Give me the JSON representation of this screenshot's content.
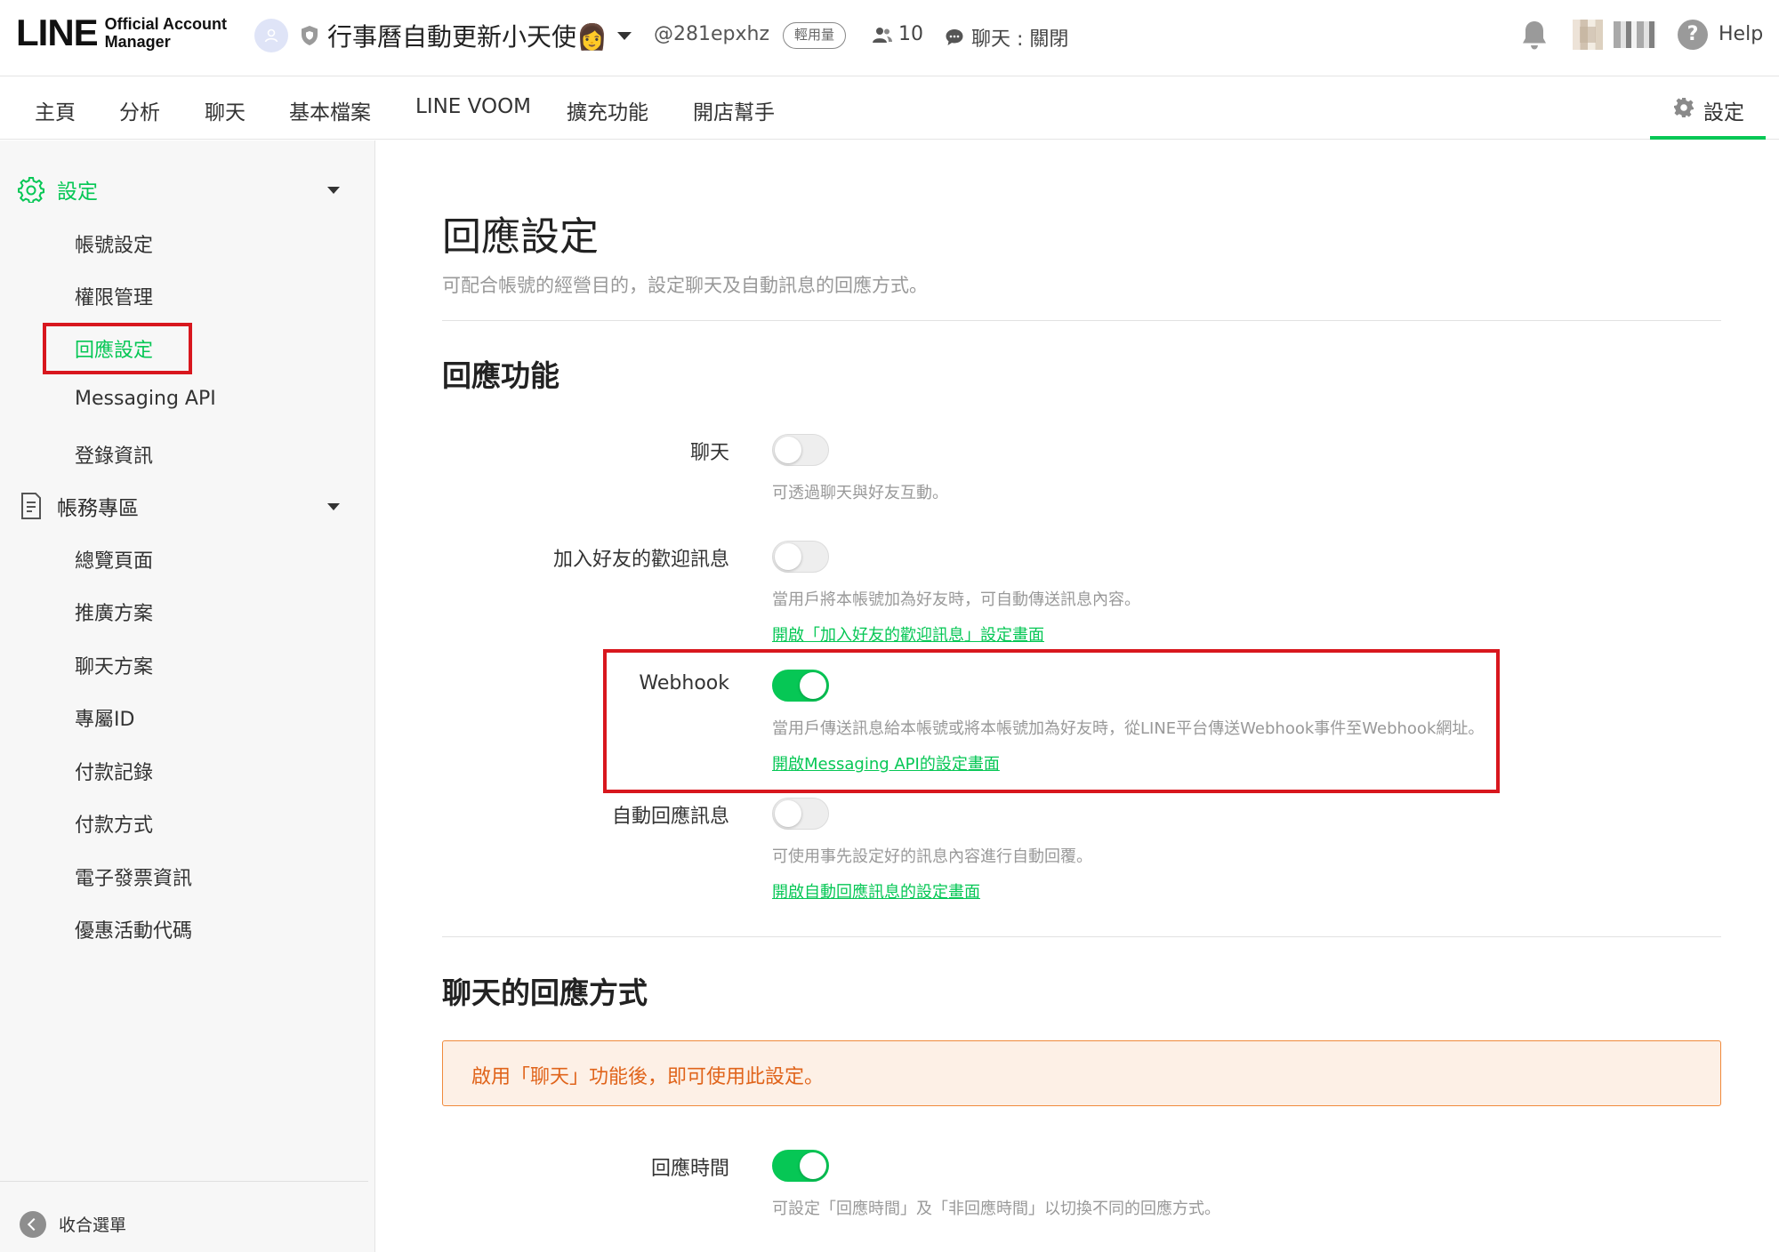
{
  "header": {
    "logo_main": "LINE",
    "logo_sub_1": "Official Account",
    "logo_sub_2": "Manager",
    "account_name": "行事曆自動更新小天使👩",
    "account_id": "@281epxhz",
    "plan_badge": "輕用量",
    "friends_count": "10",
    "chat_status": "聊天 : 關閉",
    "help_label": "Help"
  },
  "nav": {
    "tabs": [
      "主頁",
      "分析",
      "聊天",
      "基本檔案",
      "LINE VOOM",
      "擴充功能",
      "開店幫手"
    ],
    "settings_label": "設定"
  },
  "sidebar": {
    "section_settings": "設定",
    "settings_items": [
      "帳號設定",
      "權限管理",
      "回應設定",
      "Messaging API",
      "登錄資訊"
    ],
    "section_billing": "帳務專區",
    "billing_items": [
      "總覽頁面",
      "推廣方案",
      "聊天方案",
      "專屬ID",
      "付款記錄",
      "付款方式",
      "電子發票資訊",
      "優惠活動代碼"
    ],
    "collapse_label": "收合選單"
  },
  "main": {
    "title": "回應設定",
    "description": "可配合帳號的經營目的，設定聊天及自動訊息的回應方式。",
    "section_response": "回應功能",
    "rows": [
      {
        "label": "聊天",
        "enabled": false,
        "desc": "可透過聊天與好友互動。",
        "link": ""
      },
      {
        "label": "加入好友的歡迎訊息",
        "enabled": false,
        "desc": "當用戶將本帳號加為好友時，可自動傳送訊息內容。",
        "link": "開啟「加入好友的歡迎訊息」設定畫面"
      },
      {
        "label": "Webhook",
        "enabled": true,
        "desc": "當用戶傳送訊息給本帳號或將本帳號加為好友時，從LINE平台傳送Webhook事件至Webhook網址。",
        "link": "開啟Messaging API的設定畫面"
      },
      {
        "label": "自動回應訊息",
        "enabled": false,
        "desc": "可使用事先設定好的訊息內容進行自動回覆。",
        "link": "開啟自動回應訊息的設定畫面"
      }
    ],
    "section_chat_mode": "聊天的回應方式",
    "notice": "啟用「聊天」功能後，即可使用此設定。",
    "response_time": {
      "label": "回應時間",
      "enabled": true,
      "desc": "可設定「回應時間」及「非回應時間」以切換不同的回應方式。"
    }
  },
  "colors": {
    "brand_green": "#06c755",
    "highlight_red": "#d8171e",
    "notice_orange": "#e0641b"
  }
}
